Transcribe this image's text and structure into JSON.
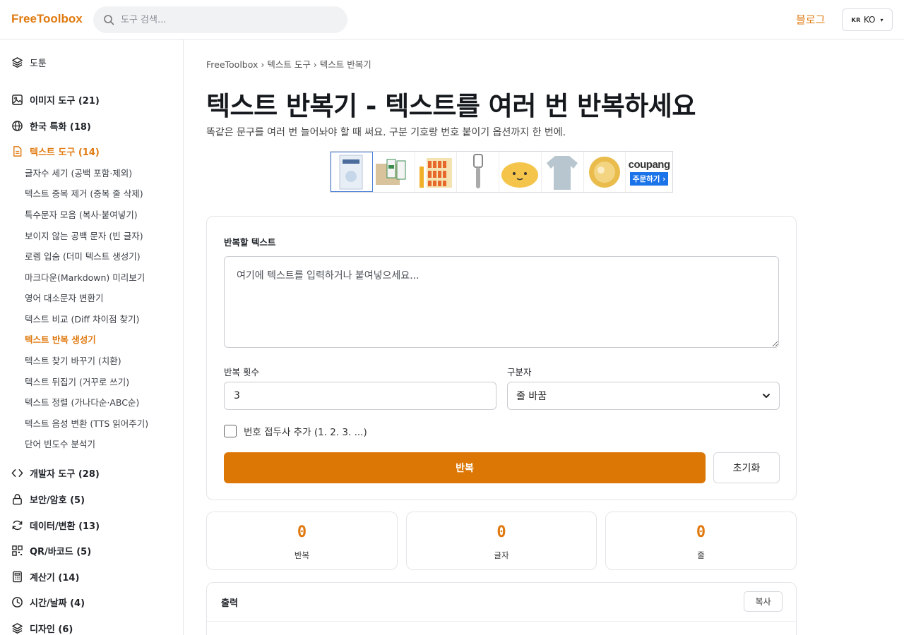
{
  "header": {
    "logo": "FreeToolbox",
    "search_placeholder": "도구 검색...",
    "blog_label": "블로그",
    "lang_flag": "KR",
    "lang_code": "KO"
  },
  "sidebar": {
    "top_item": "도툰",
    "categories": [
      {
        "label": "이미지 도구 (21)",
        "icon": "image-icon"
      },
      {
        "label": "한국 특화 (18)",
        "icon": "globe-icon"
      },
      {
        "label": "텍스트 도구 (14)",
        "icon": "document-icon"
      },
      {
        "label": "개발자 도구 (28)",
        "icon": "code-icon"
      },
      {
        "label": "보안/암호 (5)",
        "icon": "lock-icon"
      },
      {
        "label": "데이터/변환 (13)",
        "icon": "refresh-icon"
      },
      {
        "label": "QR/바코드 (5)",
        "icon": "qr-icon"
      },
      {
        "label": "계산기 (14)",
        "icon": "calculator-icon"
      },
      {
        "label": "시간/날짜 (4)",
        "icon": "clock-icon"
      },
      {
        "label": "디자인 (6)",
        "icon": "layers-icon"
      }
    ],
    "text_tools": [
      "글자수 세기 (공백 포함·제외)",
      "텍스트 중복 제거 (중복 줄 삭제)",
      "특수문자 모음 (복사·붙여넣기)",
      "보이지 않는 공백 문자 (빈 글자)",
      "로렘 입숨 (더미 텍스트 생성기)",
      "마크다운(Markdown) 미리보기",
      "영어 대소문자 변환기",
      "텍스트 비교 (Diff 차이점 찾기)",
      "텍스트 반복 생성기",
      "텍스트 찾기 바꾸기 (치환)",
      "텍스트 뒤집기 (거꾸로 쓰기)",
      "텍스트 정렬 (가나다순·ABC순)",
      "텍스트 음성 변환 (TTS 읽어주기)",
      "단어 빈도수 분석기"
    ]
  },
  "main": {
    "breadcrumb": "FreeToolbox › 텍스트 도구 › 텍스트 반복기",
    "title": "텍스트 반복기 - 텍스트를 여러 번 반복하세요",
    "description": "똑같은 문구를 여러 번 늘어놔야 할 때 써요. 구분 기호랑 번호 붙이기 옵션까지 한 번에.",
    "ad": {
      "brand": "coupang",
      "order_label": "주문하기 ›"
    },
    "form": {
      "text_label": "반복할 텍스트",
      "text_placeholder": "여기에 텍스트를 입력하거나 붙여넣으세요...",
      "count_label": "반복 횟수",
      "count_value": "3",
      "separator_label": "구분자",
      "separator_value": "줄 바꿈",
      "number_prefix_label": "번호 접두사 추가 (1. 2. 3. ...)",
      "repeat_button": "반복",
      "reset_button": "초기화"
    },
    "stats": [
      {
        "value": "0",
        "label": "반복"
      },
      {
        "value": "0",
        "label": "글자"
      },
      {
        "value": "0",
        "label": "줄"
      }
    ],
    "output": {
      "title": "출력",
      "copy_button": "복사"
    }
  }
}
